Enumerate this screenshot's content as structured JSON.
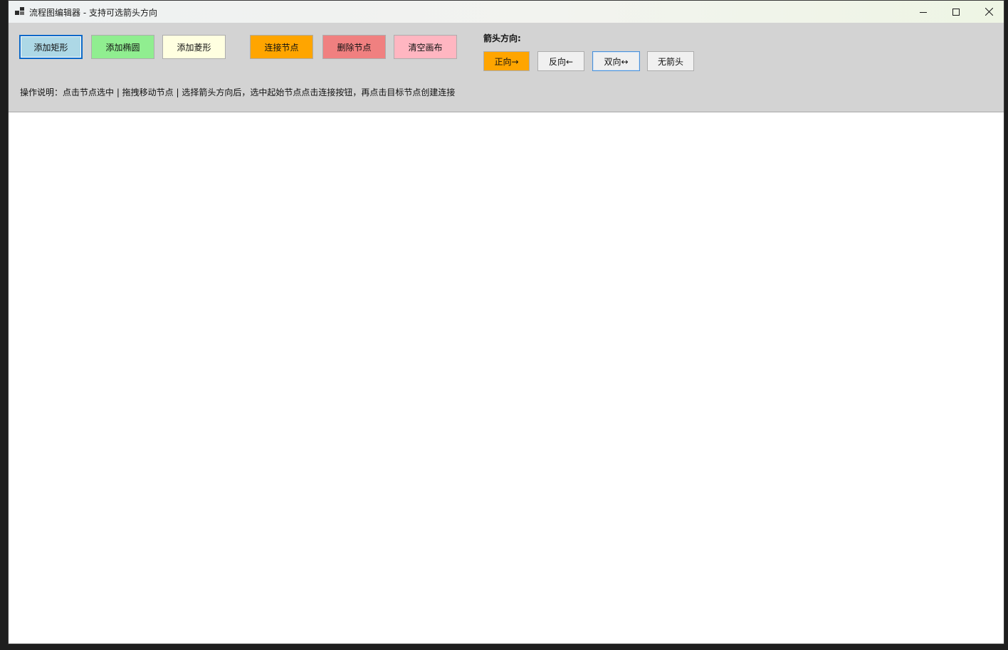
{
  "window": {
    "title": "流程图编辑器 - 支持可选箭头方向"
  },
  "toolbar": {
    "add_rect": {
      "label": "添加矩形",
      "color": "#add8e6"
    },
    "add_ellipse": {
      "label": "添加椭圆",
      "color": "#90ee90"
    },
    "add_diamond": {
      "label": "添加菱形",
      "color": "#ffffe0"
    },
    "connect": {
      "label": "连接节点",
      "color": "#ffa500"
    },
    "delete": {
      "label": "删除节点",
      "color": "#f08080"
    },
    "clear": {
      "label": "清空画布",
      "color": "#ffb6c1"
    },
    "arrow_label": "箭头方向:",
    "arrow_forward": {
      "label": "正向→",
      "color": "#ffa500",
      "selected": true
    },
    "arrow_backward": {
      "label": "反向←",
      "color": "#f0f0f0"
    },
    "arrow_both": {
      "label": "双向↔",
      "color": "#f0f0f0"
    },
    "arrow_none": {
      "label": "无箭头",
      "color": "#f0f0f0"
    },
    "hint": "操作说明：点击节点选中 | 拖拽移动节点 | 选择箭头方向后，选中起始节点点击连接按钮，再点击目标节点创建连接"
  },
  "icons": {
    "app": "flowchart-icon",
    "minimize": "minimize-icon",
    "maximize": "maximize-icon",
    "close": "close-icon"
  }
}
